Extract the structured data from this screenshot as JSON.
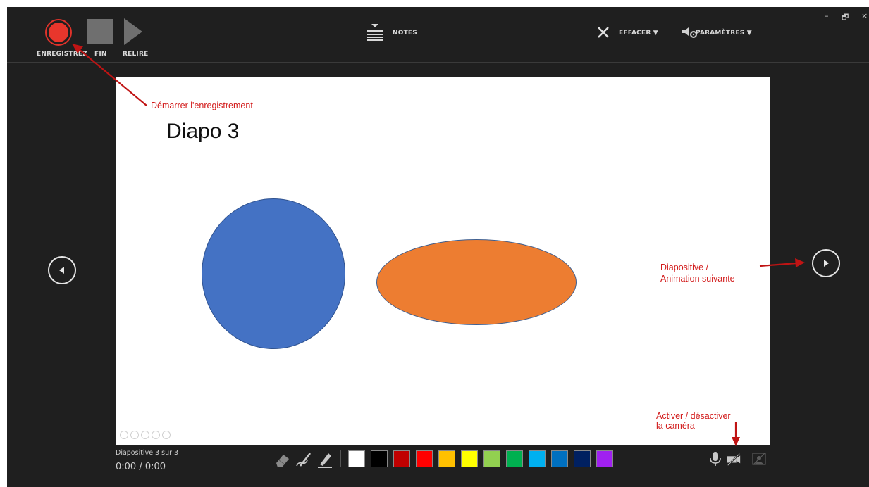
{
  "toolbar": {
    "record_label": "ENREGISTREZ",
    "end_label": "FIN",
    "replay_label": "RELIRE",
    "notes_label": "NOTES",
    "clear_label": "EFFACER ▼",
    "settings_label": "PARAMÈTRES ▼"
  },
  "window_controls": {
    "minimize": "–",
    "restore": "🗗",
    "close": "×"
  },
  "slide": {
    "title": "Diapo 3"
  },
  "annotations": {
    "start_recording": "Démarrer l'enregistrement",
    "next_slide_line1": "Diapositive /",
    "next_slide_line2": "Animation suivante",
    "camera_line1": "Activer / désactiver",
    "camera_line2": "la caméra"
  },
  "status": {
    "slide_counter": "Diapositive 3 sur 3",
    "timer": "0:00 / 0:00"
  },
  "palette": {
    "colors": [
      "#ffffff",
      "#000000",
      "#c00000",
      "#ff0000",
      "#ffc000",
      "#ffff00",
      "#92d050",
      "#00b050",
      "#00b0f0",
      "#0070c0",
      "#002060",
      "#a020f0"
    ]
  },
  "icons": {
    "record": "record-icon",
    "stop": "stop-icon",
    "play": "play-icon",
    "notes": "notes-icon",
    "clear": "close-x-icon",
    "settings": "settings-icon",
    "prev": "chevron-left-icon",
    "next": "chevron-right-icon",
    "eraser": "eraser-icon",
    "pen": "pen-icon",
    "highlighter": "highlighter-icon",
    "microphone": "microphone-icon",
    "camera_off": "camera-off-icon",
    "camera_preview": "camera-preview-icon"
  }
}
